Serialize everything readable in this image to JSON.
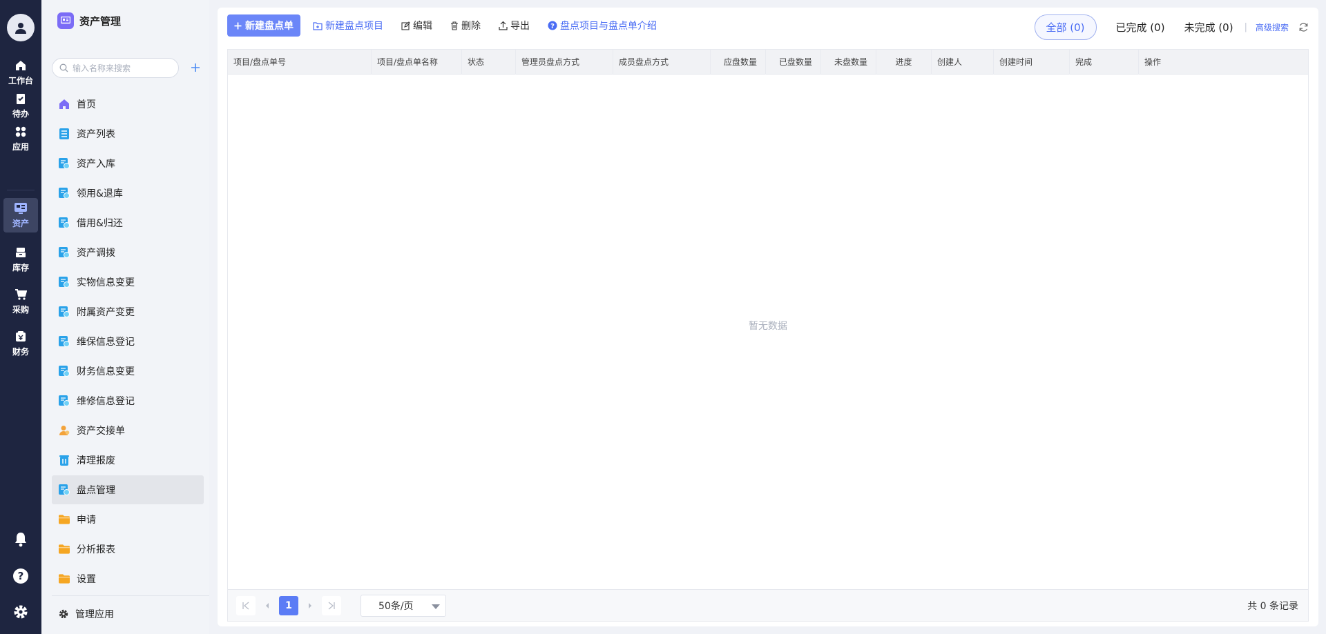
{
  "rail": {
    "items": [
      {
        "label": "工作台",
        "icon": "home-icon"
      },
      {
        "label": "待办",
        "icon": "clipboard-check-icon"
      },
      {
        "label": "应用",
        "icon": "grid-icon"
      },
      {
        "label": "资产",
        "icon": "asset-icon"
      },
      {
        "label": "库存",
        "icon": "inventory-icon"
      },
      {
        "label": "采购",
        "icon": "cart-icon"
      },
      {
        "label": "财务",
        "icon": "finance-icon"
      }
    ],
    "active": "资产",
    "bottom_icons": [
      "bell-icon",
      "help-icon",
      "settings-icon"
    ]
  },
  "sidebar": {
    "app_title": "资产管理",
    "search_placeholder": "输入名称来搜索",
    "items": [
      {
        "label": "首页",
        "icon": "home-icon"
      },
      {
        "label": "资产列表",
        "icon": "list-icon"
      },
      {
        "label": "资产入库",
        "icon": "form-icon"
      },
      {
        "label": "领用&退库",
        "icon": "form-icon"
      },
      {
        "label": "借用&归还",
        "icon": "form-icon"
      },
      {
        "label": "资产调拨",
        "icon": "form-icon"
      },
      {
        "label": "实物信息变更",
        "icon": "form-icon"
      },
      {
        "label": "附属资产变更",
        "icon": "form-icon"
      },
      {
        "label": "维保信息登记",
        "icon": "form-icon"
      },
      {
        "label": "财务信息变更",
        "icon": "form-icon"
      },
      {
        "label": "维修信息登记",
        "icon": "form-icon"
      },
      {
        "label": "资产交接单",
        "icon": "person-icon"
      },
      {
        "label": "清理报废",
        "icon": "trash-icon"
      },
      {
        "label": "盘点管理",
        "icon": "form-icon"
      },
      {
        "label": "申请",
        "icon": "folder-icon"
      },
      {
        "label": "分析报表",
        "icon": "folder-icon"
      },
      {
        "label": "设置",
        "icon": "folder-icon"
      }
    ],
    "active": "盘点管理",
    "manage_label": "管理应用"
  },
  "toolbar": {
    "new_sheet": "新建盘点单",
    "new_project": "新建盘点项目",
    "edit": "编辑",
    "delete": "删除",
    "export": "导出",
    "intro": "盘点项目与盘点单介绍"
  },
  "filters": {
    "all": "全部 (0)",
    "done": "已完成 (0)",
    "undone": "未完成 (0)",
    "advanced": "高级搜索"
  },
  "table": {
    "columns": [
      "项目/盘点单号",
      "项目/盘点单名称",
      "状态",
      "管理员盘点方式",
      "成员盘点方式",
      "应盘数量",
      "已盘数量",
      "未盘数量",
      "进度",
      "创建人",
      "创建时间",
      "完成",
      "操作"
    ],
    "empty_text": "暂无数据"
  },
  "pager": {
    "current_page": "1",
    "page_size": "50条/页",
    "total": "共 0 条记录"
  },
  "colors": {
    "rail_bg": "#1e2540",
    "accent": "#6b86f8",
    "link": "#4a6cf4"
  }
}
